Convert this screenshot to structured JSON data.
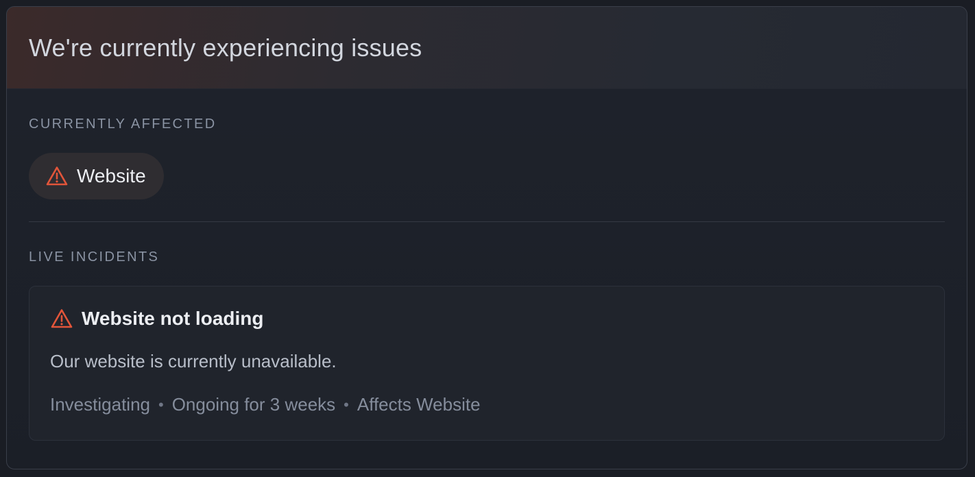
{
  "header": {
    "title": "We're currently experiencing issues"
  },
  "affected": {
    "label": "CURRENTLY AFFECTED",
    "components": [
      {
        "name": "Website",
        "icon": "warning-triangle-icon"
      }
    ]
  },
  "incidents": {
    "label": "LIVE INCIDENTS",
    "items": [
      {
        "title": "Website not loading",
        "icon": "warning-triangle-icon",
        "description": "Our website is currently unavailable.",
        "status": "Investigating",
        "duration": "Ongoing for 3 weeks",
        "affects": "Affects Website",
        "separator": "•"
      }
    ]
  },
  "colors": {
    "warning": "#e2553a",
    "background": "#1a1d24",
    "text_primary": "#eceef2",
    "text_muted": "#858d9c"
  }
}
